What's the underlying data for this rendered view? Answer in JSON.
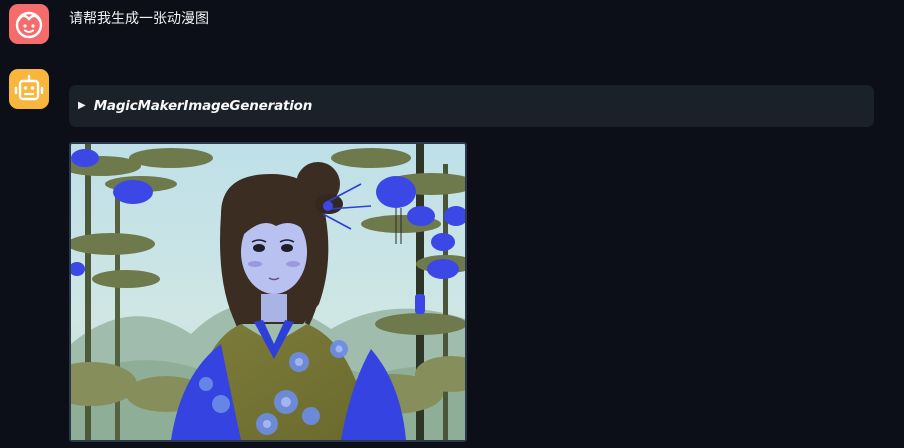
{
  "messages": {
    "user": {
      "avatar_icon": "girl-face-icon",
      "avatar_color": "#f56c6c",
      "text": "请帮我生成一张动漫图"
    },
    "assistant": {
      "avatar_icon": "robot-face-icon",
      "avatar_color": "#f8b63d",
      "tool_call": {
        "expand_icon": "triangle-right-icon",
        "name": "MagicMakerImageGeneration"
      },
      "image": {
        "subject": "anime-illustration-girl-in-kimono-with-blue-lanterns"
      }
    }
  },
  "colors": {
    "background": "#0c0f17",
    "panel": "#1b2129",
    "text": "#f1f3f6"
  }
}
